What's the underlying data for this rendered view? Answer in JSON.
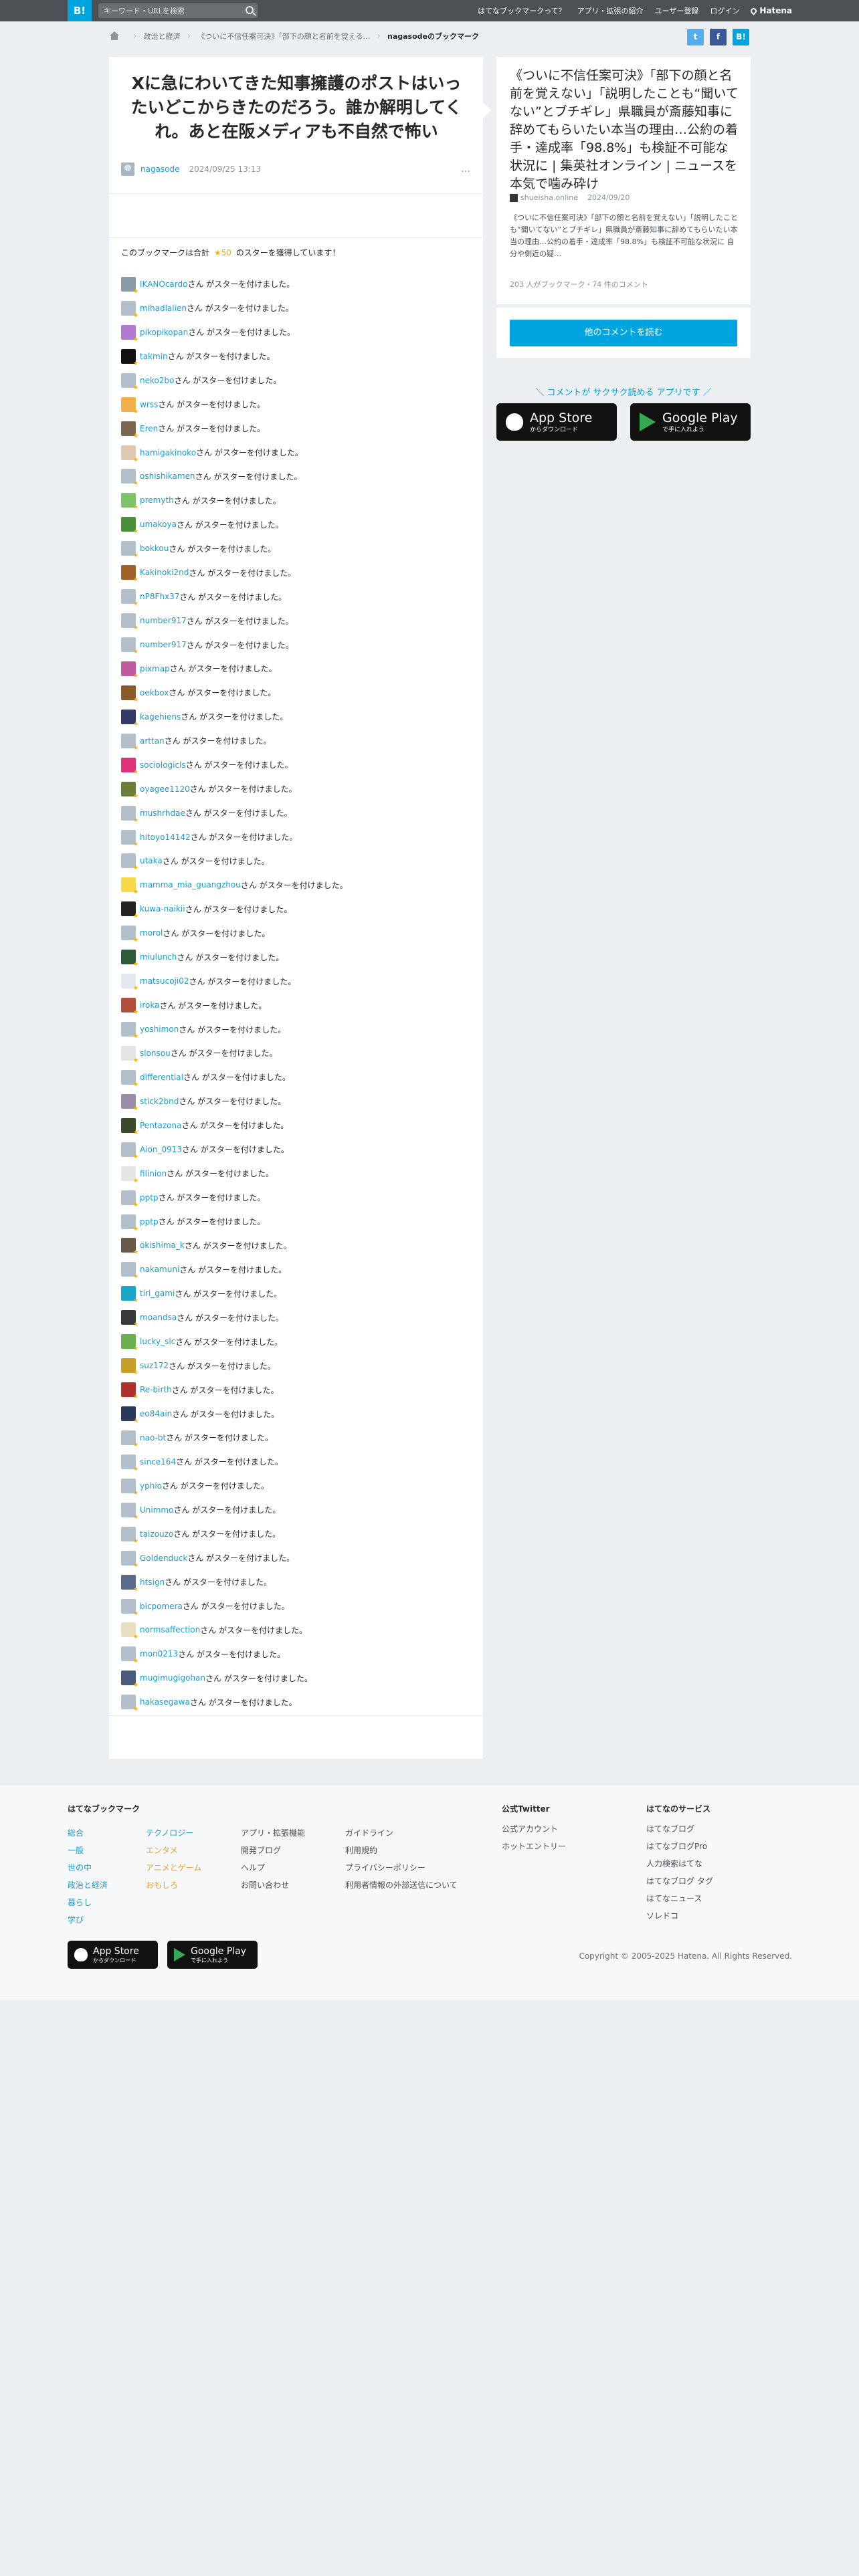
{
  "topbar": {
    "logo": "B!",
    "search_placeholder": "キーワード・URLを検索",
    "nav": [
      "はてなブックマークって？",
      "アプリ・拡張の紹介",
      "ユーザー登録",
      "ログイン"
    ],
    "brand": "Hatena"
  },
  "breadcrumb": {
    "items": [
      "政治と経済",
      "《ついに不信任案可決》「部下の顔と名前を覚える…",
      "nagasodeのブックマーク"
    ]
  },
  "share": {
    "tw": "t",
    "fb": "f",
    "hb": "B!"
  },
  "bookmark": {
    "comment": "Xに急にわいてきた知事擁護のポストはいったいどこからきたのだろう。誰か解明してくれ。あと在阪メディアも不自然で怖い",
    "user": "nagasode",
    "date": "2024/09/25 13:13",
    "more": "…"
  },
  "summary": {
    "prefix": "このブックマークは合計",
    "count": "50",
    "suffix": "のスターを獲得しています！",
    "star": "★"
  },
  "star_suffix": "さん がスターを付けました。",
  "stars": [
    {
      "name": "IKANOcardo",
      "color": "#8a9aa8"
    },
    {
      "name": "mihadlalien",
      "color": "#b3c0cc"
    },
    {
      "name": "pikopikopan",
      "color": "#b07ad0"
    },
    {
      "name": "takmin",
      "color": "#111111"
    },
    {
      "name": "neko2bo",
      "color": "#b3c0cc"
    },
    {
      "name": "wrss",
      "color": "#f2b04b"
    },
    {
      "name": "Eren",
      "color": "#7a6750"
    },
    {
      "name": "hamigakinoko",
      "color": "#e0c9b0"
    },
    {
      "name": "oshishikamen",
      "color": "#b3c0cc"
    },
    {
      "name": "premyth",
      "color": "#7fc36b"
    },
    {
      "name": "umakoya",
      "color": "#4a8f3a"
    },
    {
      "name": "bokkou",
      "color": "#b3c0cc"
    },
    {
      "name": "Kakinoki2nd",
      "color": "#a0642b"
    },
    {
      "name": "nP8Fhx37",
      "color": "#b3c0cc"
    },
    {
      "name": "number917",
      "color": "#b3c0cc"
    },
    {
      "name": "number917",
      "color": "#b3c0cc"
    },
    {
      "name": "pixmap",
      "color": "#c25a9f"
    },
    {
      "name": "oekbox",
      "color": "#8a5a2a"
    },
    {
      "name": "kagehiens",
      "color": "#333a66"
    },
    {
      "name": "arttan",
      "color": "#b3c0cc"
    },
    {
      "name": "sociologicls",
      "color": "#e0307a"
    },
    {
      "name": "oyagee1120",
      "color": "#6a7f3a"
    },
    {
      "name": "mushrhdae",
      "color": "#b3c0cc"
    },
    {
      "name": "hitoyo14142",
      "color": "#b3c0cc"
    },
    {
      "name": "utaka",
      "color": "#b3c0cc"
    },
    {
      "name": "mamma_mia_guangzhou",
      "color": "#f7d948"
    },
    {
      "name": "kuwa-naikii",
      "color": "#222222"
    },
    {
      "name": "morol",
      "color": "#b3c0cc"
    },
    {
      "name": "miulunch",
      "color": "#2f5a3a"
    },
    {
      "name": "matsucoji02",
      "color": "#e2e8ee"
    },
    {
      "name": "iroka",
      "color": "#b0503a"
    },
    {
      "name": "yoshimon",
      "color": "#b3c0cc"
    },
    {
      "name": "slonsou",
      "color": "#e4e4e4"
    },
    {
      "name": "differential",
      "color": "#b3c0cc"
    },
    {
      "name": "stick2bnd",
      "color": "#9b8ea8"
    },
    {
      "name": "Pentazona",
      "color": "#3a4a2a"
    },
    {
      "name": "Aion_0913",
      "color": "#b3c0cc"
    },
    {
      "name": "filinion",
      "color": "#e6e6e6"
    },
    {
      "name": "pptp",
      "color": "#b3c0cc"
    },
    {
      "name": "pptp",
      "color": "#b3c0cc"
    },
    {
      "name": "okishima_k",
      "color": "#6a5a4a"
    },
    {
      "name": "nakamuni",
      "color": "#b3c0cc"
    },
    {
      "name": "tiri_gami",
      "color": "#1aa7c7"
    },
    {
      "name": "moandsa",
      "color": "#3a3a3a"
    },
    {
      "name": "lucky_slc",
      "color": "#6ab04c"
    },
    {
      "name": "suz172",
      "color": "#c8a028"
    },
    {
      "name": "Re-birth",
      "color": "#b0302a"
    },
    {
      "name": "eo84ain",
      "color": "#2a3a5a"
    },
    {
      "name": "nao-bt",
      "color": "#b3c0cc"
    },
    {
      "name": "since164",
      "color": "#b3c0cc"
    },
    {
      "name": "yphio",
      "color": "#b3c0cc"
    },
    {
      "name": "Unimmo",
      "color": "#b3c0cc"
    },
    {
      "name": "taizouzo",
      "color": "#b3c0cc"
    },
    {
      "name": "Goldenduck",
      "color": "#b3c0cc"
    },
    {
      "name": "htsign",
      "color": "#5a6a8a"
    },
    {
      "name": "bicpomera",
      "color": "#b3c0cc"
    },
    {
      "name": "normsaffection",
      "color": "#e6e0c0"
    },
    {
      "name": "mon0213",
      "color": "#b3c0cc"
    },
    {
      "name": "mugimugigohan",
      "color": "#4a5a7a"
    },
    {
      "name": "hakasegawa",
      "color": "#b3c0cc"
    }
  ],
  "entry": {
    "title": "《ついに不信任案可決》「部下の顔と名前を覚えない」「説明したことも“聞いてない”とブチギレ」県職員が斎藤知事に辞めてもらいたい本当の理由…公約の着手・達成率「98.8%」も検証不可能な状況に | 集英社オンライン | ニュースを本気で噛み砕け",
    "site": "shueisha.online",
    "date": "2024/09/20",
    "desc": "《ついに不信任案可決》「部下の顔と名前を覚えない」「説明したことも“聞いてない”とブチギレ」県職員が斎藤知事に辞めてもらいたい本当の理由…公約の着手・達成率「98.8%」も検証不可能な状況に 自分や側近の疑…",
    "counts": "203 人がブックマーク・74 件のコメント",
    "more_button": "他のコメントを読む"
  },
  "promo": {
    "text": "＼ コメントが サクサク読める アプリです ／",
    "appstore_big": "App Store",
    "appstore_small": "からダウンロード",
    "play_big": "Google Play",
    "play_small": "で手に入れよう"
  },
  "footer": {
    "col1_head": "はてなブックマーク",
    "col1_a": [
      "総合",
      "一般",
      "世の中",
      "政治と経済",
      "暮らし",
      "学び"
    ],
    "col1_b": [
      "テクノロジー",
      "エンタメ",
      "アニメとゲーム",
      "おもしろ"
    ],
    "col1_c": [
      "アプリ・拡張機能",
      "開発ブログ",
      "ヘルプ",
      "お問い合わせ"
    ],
    "col1_d": [
      "ガイドライン",
      "利用規約",
      "プライバシーポリシー",
      "利用者情報の外部送信について"
    ],
    "col2_head": "公式Twitter",
    "col2": [
      "公式アカウント",
      "ホットエントリー"
    ],
    "col3_head": "はてなのサービス",
    "col3": [
      "はてなブログ",
      "はてなブログPro",
      "人力検索はてな",
      "はてなブログ タグ",
      "はてなニュース",
      "ソレドコ"
    ],
    "appstore_big": "App Store",
    "appstore_small": "からダウンロード",
    "play_big": "Google Play",
    "play_small": "で手に入れよう",
    "copyright": "Copyright © 2005-2025 Hatena. All Rights Reserved."
  }
}
